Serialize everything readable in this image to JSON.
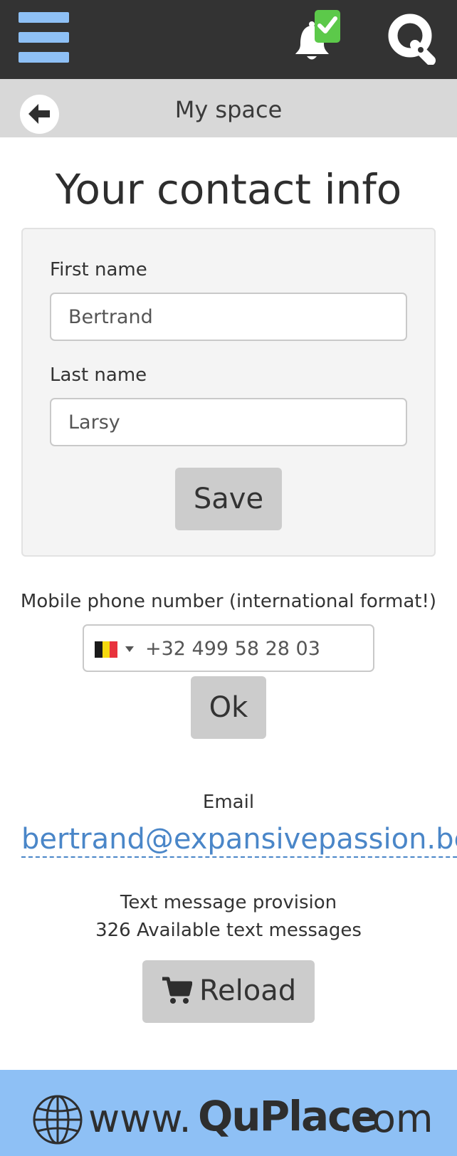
{
  "header": {
    "menu_icon": "hamburger-icon",
    "notification_icon": "bell-icon",
    "notification_badge_icon": "checkmark-icon",
    "logo_icon": "quplace-q-logo"
  },
  "subheader": {
    "back_icon": "arrow-left-icon",
    "title": "My space"
  },
  "page": {
    "title": "Your contact info"
  },
  "form": {
    "first_name_label": "First name",
    "first_name_value": "Bertrand",
    "last_name_label": "Last name",
    "last_name_value": "Larsy",
    "save_label": "Save"
  },
  "phone": {
    "label": "Mobile phone number (international format!)",
    "country": "BE",
    "flag_colors": [
      "#1a1a1a",
      "#f5d90f",
      "#e8323c"
    ],
    "value": "+32 499 58 28 03",
    "ok_label": "Ok"
  },
  "email": {
    "label": "Email",
    "value": "bertrand@expansivepassion.be"
  },
  "sms": {
    "title": "Text message provision",
    "count_text": "326 Available text messages",
    "reload_label": "Reload",
    "reload_icon": "cart-icon"
  },
  "footer": {
    "globe_icon": "globe-icon",
    "www": "www.",
    "brand": "QuPlace",
    "tld": ".com"
  },
  "colors": {
    "topbar": "#333333",
    "accent": "#8ec0f5",
    "link": "#4a86c8",
    "button": "#cccccc",
    "badge": "#5cc94a"
  }
}
